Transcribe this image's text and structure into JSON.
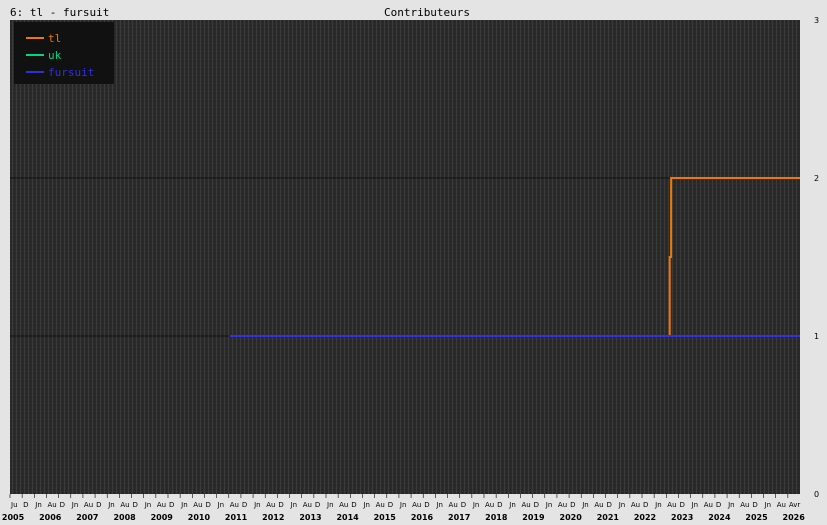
{
  "header": {
    "left_title": "6: tl - fursuit",
    "center_title": "Contributeurs"
  },
  "colors": {
    "background": "#e4e4e4",
    "plot_background": "#2b2b2b",
    "grid": "#111111",
    "text": "#000000",
    "legend_background": "#111111",
    "legend_text": "#dddddd"
  },
  "chart_data": {
    "type": "line",
    "title": "Contributeurs",
    "xlabel": "",
    "ylabel": "",
    "xlim": [
      "2005-06-01",
      "2026-09-01"
    ],
    "ylim": [
      0,
      3
    ],
    "yticks": [
      0,
      1,
      2,
      3
    ],
    "year_labels": [
      "2005",
      "2006",
      "2007",
      "2008",
      "2009",
      "2010",
      "2011",
      "2012",
      "2013",
      "2014",
      "2015",
      "2016",
      "2017",
      "2018",
      "2019",
      "2020",
      "2021",
      "2022",
      "2023",
      "2024",
      "2025",
      "2026"
    ],
    "month_tick_labels": [
      "Ju",
      "D",
      "Jn",
      "Au",
      "D",
      "Jn",
      "Au",
      "D",
      "Jn",
      "Au",
      "D",
      "Jn",
      "Au",
      "D",
      "Jn",
      "Au",
      "D",
      "Jn",
      "Au",
      "D",
      "Jn",
      "Au",
      "D",
      "Jn",
      "Au",
      "D",
      "Jn",
      "Au",
      "D",
      "Jn",
      "Au",
      "D",
      "Jn",
      "Au",
      "D",
      "Jn",
      "Au",
      "D",
      "Jn",
      "Au",
      "D",
      "Jn",
      "Au",
      "D",
      "Jn",
      "Au",
      "D",
      "Jn",
      "Au",
      "D",
      "Jn",
      "Au",
      "D",
      "Jn",
      "Au",
      "D",
      "Jn",
      "Au",
      "D",
      "Jn",
      "Au",
      "D",
      "Jn",
      "Au",
      "Avr"
    ],
    "grid": true,
    "legend_position": "top-left",
    "series": [
      {
        "name": "tl",
        "color": "#f07800",
        "points": [
          [
            "2023-03-01",
            1
          ],
          [
            "2023-03-01",
            1.5
          ],
          [
            "2023-03-15",
            1.5
          ],
          [
            "2023-03-15",
            2
          ],
          [
            "2026-09-01",
            2
          ]
        ]
      },
      {
        "name": "uk",
        "color": "#00d880",
        "points": []
      },
      {
        "name": "fursuit",
        "color": "#3030e0",
        "points": [
          [
            "2011-05-01",
            1
          ],
          [
            "2026-09-01",
            1
          ]
        ]
      }
    ]
  }
}
